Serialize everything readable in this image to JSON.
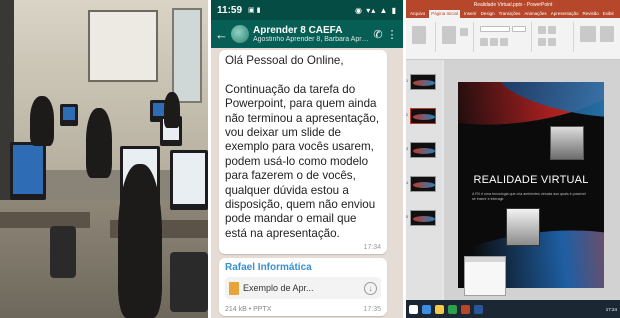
{
  "phone": {
    "status_time": "11:59",
    "status_left_icons": "▣ ▮",
    "status_right_icons": "◉ ▾▴ ▲ ▮",
    "group_name": "Aprender 8 CAEFA",
    "group_members": "Agostinho Aprender 8, Barbara Aprender 8, Bet...",
    "message_text": "Olá Pessoal do Online,\n\nContinuação da tarefa do Powerpoint, para quem ainda não terminou a apresentação, vou deixar um slide de exemplo para vocês usarem, podem usá-lo como modelo para fazerem o de vocês, qualquer dúvida estou a disposição, quem não enviou pode mandar o email que está na apresentação.",
    "message_time": "17:34",
    "file_sender": "Rafael Informática",
    "file_name": "Exemplo de Apr...",
    "file_meta": "214 kB • PPTX",
    "file_time": "17:35",
    "back_icon": "←",
    "call_icon": "✆",
    "menu_icon": "⋮",
    "download_icon": "↓"
  },
  "ppt": {
    "window_title": "Realidade Virtual.pptx - PowerPoint",
    "tabs": [
      "Arquivo",
      "Página Inicial",
      "Inserir",
      "Design",
      "Transições",
      "Animações",
      "Apresentação",
      "Revisão",
      "Exibir"
    ],
    "slide_title": "REALIDADE VIRTUAL",
    "slide_body": "A RV é uma tecnologia que cria ambientes virtuais aos quais é possível se inserir e interagir.",
    "thumb_numbers": [
      "1",
      "2",
      "3",
      "4",
      "5"
    ],
    "clock": "17:24"
  },
  "colors": {
    "whatsapp_header": "#075e54",
    "ppt_accent": "#b7472a",
    "sender": "#3a8fcf"
  }
}
